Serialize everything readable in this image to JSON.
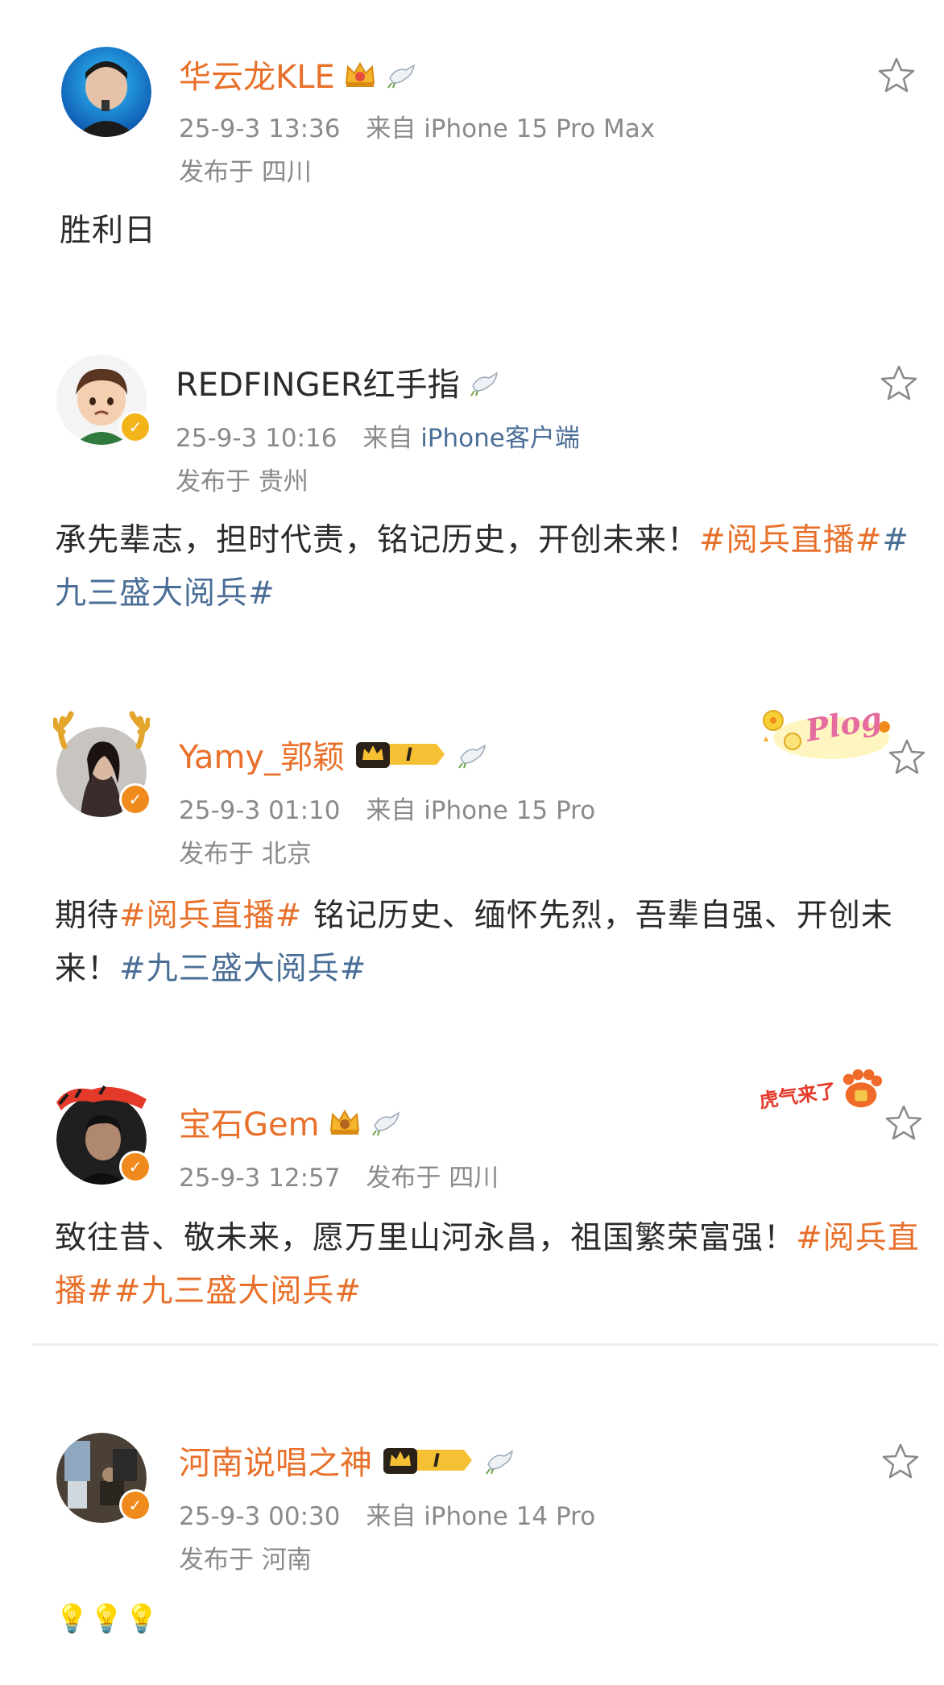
{
  "posts": [
    {
      "name": "华云龙KLE",
      "time": "25-9-3 13:36",
      "source_prefix": "来自",
      "source": "iPhone 15 Pro Max",
      "location_prefix": "发布于",
      "location": "四川",
      "text": "胜利日"
    },
    {
      "name": "REDFINGER红手指",
      "time": "25-9-3 10:16",
      "source_prefix": "来自",
      "source": "iPhone客户端",
      "location_prefix": "发布于",
      "location": "贵州",
      "text_plain": "承先辈志，担时代责，铭记历史，开创未来！",
      "topic1": "#阅兵直播#",
      "topic2": "#九三盛大阅兵#"
    },
    {
      "name": "Yamy_郭颖",
      "vip_level": "I",
      "time": "25-9-3 01:10",
      "source_prefix": "来自",
      "source": "iPhone 15 Pro",
      "location_prefix": "发布于",
      "location": "北京",
      "text_a": "期待",
      "topic1": "#阅兵直播#",
      "text_b": " 铭记历史、缅怀先烈，吾辈自强、开创未来！",
      "topic2": "#九三盛大阅兵#",
      "sticker_text": "Plog"
    },
    {
      "name": "宝石Gem",
      "time": "25-9-3 12:57",
      "location_prefix": "发布于",
      "location": "四川",
      "text_plain": "致往昔、敬未来，愿万里山河永昌，祖国繁荣富强！",
      "topic1": "#阅兵直播#",
      "topic2": "#九三盛大阅兵#",
      "sticker_text": "虎气来了"
    },
    {
      "name": "河南说唱之神",
      "vip_level": "I",
      "time": "25-9-3 00:30",
      "source_prefix": "来自",
      "source": "iPhone 14 Pro",
      "location_prefix": "发布于",
      "location": "河南",
      "text": "💡💡💡"
    }
  ],
  "colors": {
    "username_orange": "#e8702a",
    "topic_orange": "#e8702a",
    "topic_blue": "#4a6e96",
    "meta_gray": "#8a8a8a",
    "verified_orange": "#f08a1c"
  },
  "icons": [
    "crown-badge-icon",
    "dove-badge-icon",
    "vip-level-badge-icon",
    "verified-icon",
    "star-icon"
  ]
}
